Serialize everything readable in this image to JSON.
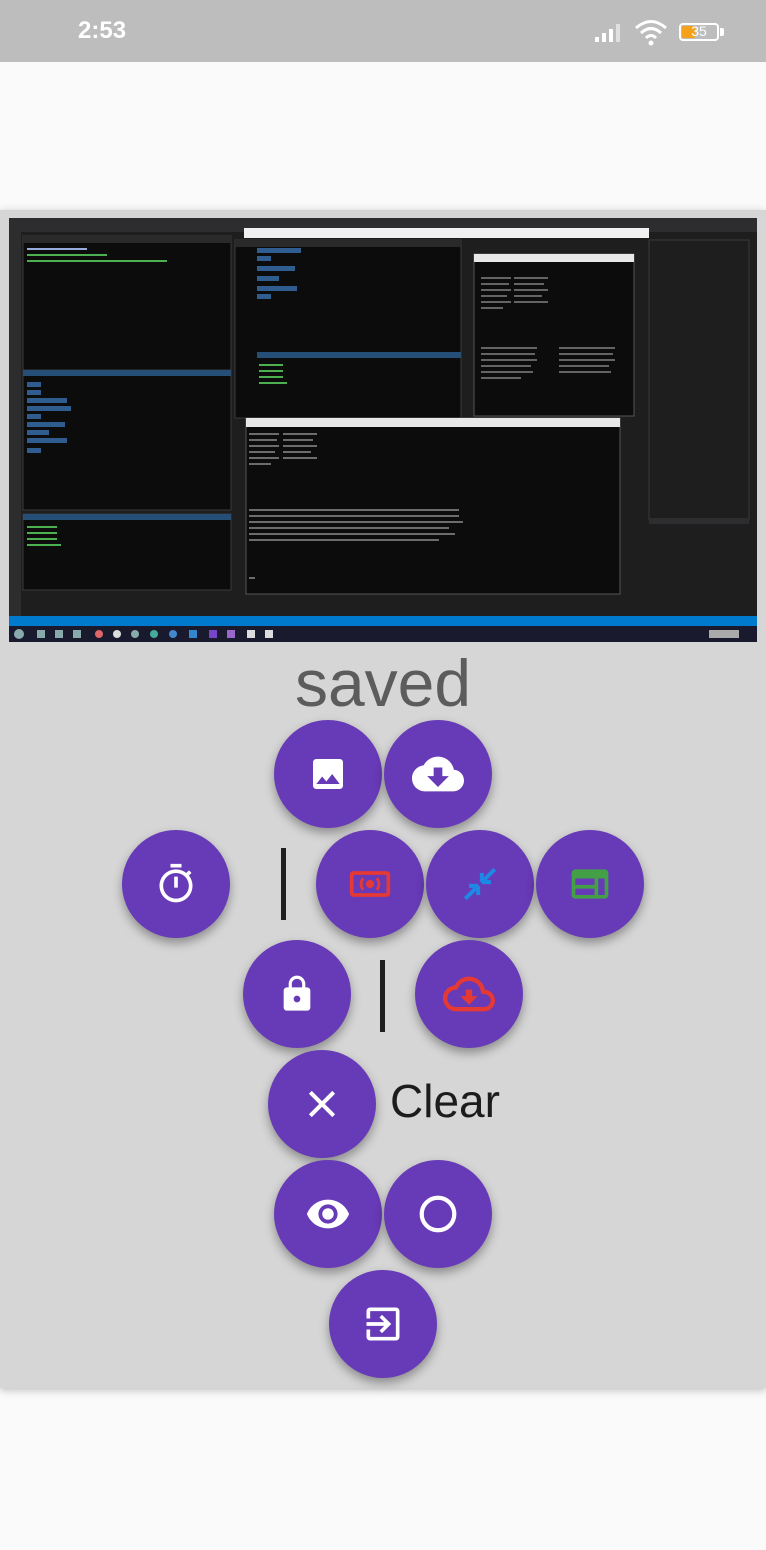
{
  "status_bar": {
    "time": "2:53",
    "battery_level": "35",
    "battery_fraction": 0.35,
    "icons": [
      "signal-icon",
      "wifi-icon",
      "battery-icon"
    ]
  },
  "preview": {
    "saved_label": "saved",
    "screenshot_image": "desktop-terminal-screenshot"
  },
  "actions": {
    "row1": [
      {
        "name": "gallery-button",
        "icon": "image-icon",
        "color": "#ffffff"
      },
      {
        "name": "cloud-download-button",
        "icon": "cloud-download-icon",
        "color": "#ffffff"
      }
    ],
    "row2": [
      {
        "name": "timer-button",
        "icon": "timer-icon",
        "color": "#ffffff"
      },
      {
        "name": "capture-mode-button",
        "icon": "screen-capture-icon",
        "color": "#e53935"
      },
      {
        "name": "shrink-button",
        "icon": "arrows-in-icon",
        "color": "#1e88e5"
      },
      {
        "name": "layout-button",
        "icon": "web-layout-icon",
        "color": "#43a047"
      }
    ],
    "row3": [
      {
        "name": "lock-button",
        "icon": "lock-icon",
        "color": "#ffffff"
      },
      {
        "name": "cloud-download-red-button",
        "icon": "cloud-download-icon",
        "color": "#e53935"
      }
    ],
    "clear": {
      "label": "Clear",
      "icon": "close-icon"
    },
    "row5": [
      {
        "name": "preview-button",
        "icon": "eye-icon",
        "color": "#ffffff"
      },
      {
        "name": "record-button",
        "icon": "circle-outline-icon",
        "color": "#ffffff"
      }
    ],
    "exit": {
      "icon": "exit-to-app-icon",
      "color": "#ffffff"
    }
  },
  "colors": {
    "fab": "#673ab7",
    "panel": "#d6d6d6",
    "status_bar": "#bdbdbd"
  }
}
